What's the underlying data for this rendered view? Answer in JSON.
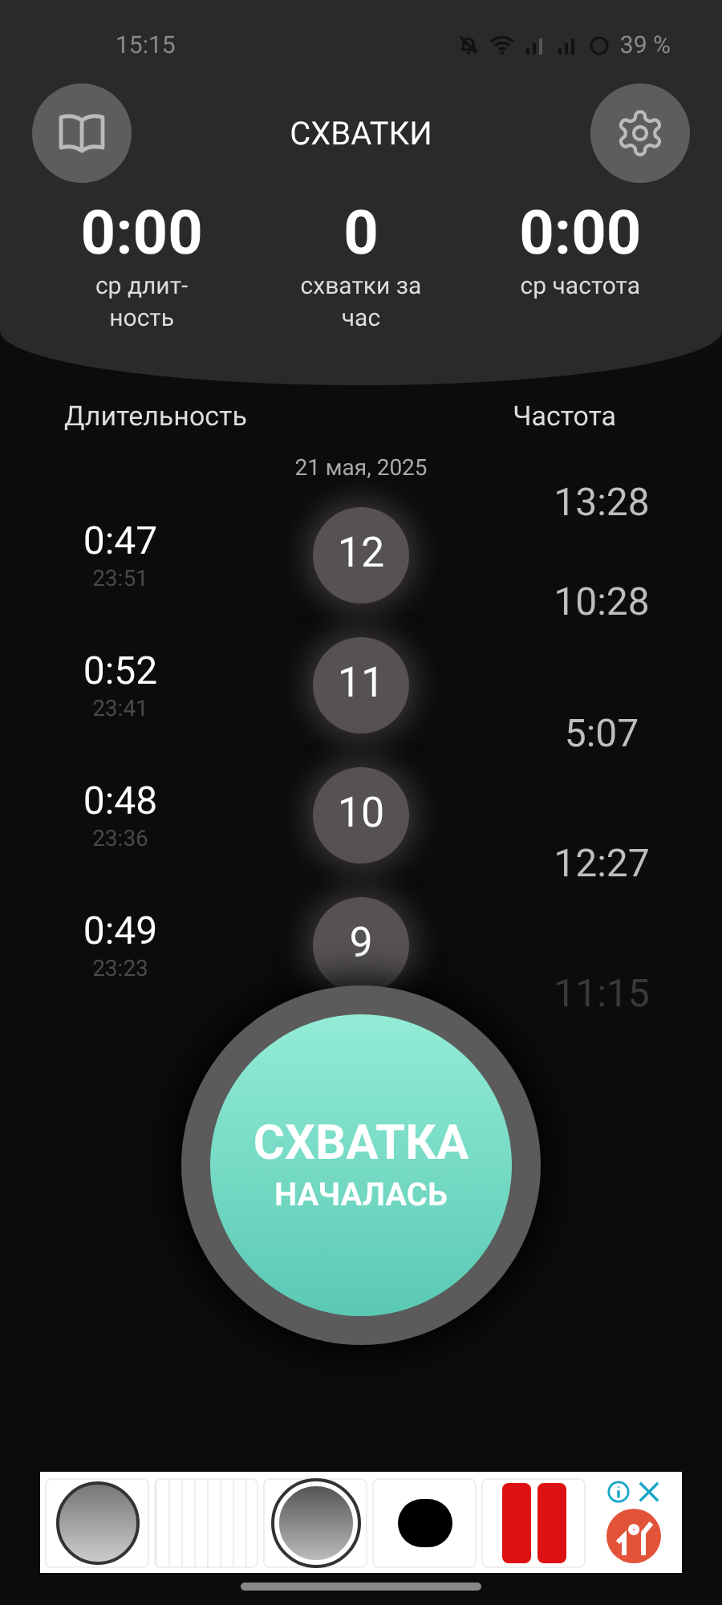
{
  "status_bar": {
    "time": "15:15",
    "battery": "39 %"
  },
  "header": {
    "title": "СХВАТКИ"
  },
  "stats": [
    {
      "value": "0:00",
      "label": "ср длит-ность"
    },
    {
      "value": "0",
      "label": "схватки за час"
    },
    {
      "value": "0:00",
      "label": "ср частота"
    }
  ],
  "columns": {
    "duration": "Длительность",
    "frequency": "Частота"
  },
  "date": "21 мая, 2025",
  "contractions": [
    {
      "number": "12",
      "duration": "0:47",
      "time": "23:51"
    },
    {
      "number": "11",
      "duration": "0:52",
      "time": "23:41"
    },
    {
      "number": "10",
      "duration": "0:48",
      "time": "23:36"
    },
    {
      "number": "9",
      "duration": "0:49",
      "time": "23:23"
    }
  ],
  "frequencies": [
    "13:28",
    "10:28",
    "5:07",
    "12:27",
    "11:15"
  ],
  "start_button": {
    "line_1": "СХВАТКА",
    "line_2": "НАЧАЛАСЬ"
  }
}
